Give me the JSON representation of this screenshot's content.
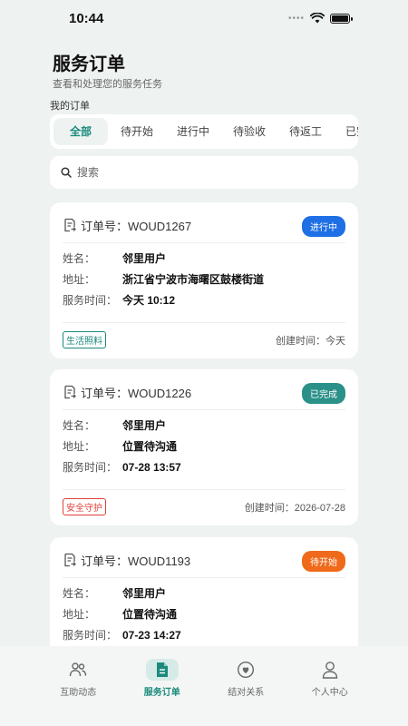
{
  "status_bar": {
    "time": "10:44"
  },
  "header": {
    "title": "服务订单",
    "subtitle": "查看和处理您的服务任务",
    "section_label": "我的订单"
  },
  "tabs": [
    {
      "label": "全部",
      "active": true
    },
    {
      "label": "待开始"
    },
    {
      "label": "进行中"
    },
    {
      "label": "待验收"
    },
    {
      "label": "待返工"
    },
    {
      "label": "已完成"
    }
  ],
  "search": {
    "placeholder": "搜索"
  },
  "labels": {
    "order_prefix": "订单号：",
    "name": "姓名：",
    "address": "地址：",
    "service_time": "服务时间：",
    "created": "创建时间："
  },
  "orders": [
    {
      "order_no": "WOUD1267",
      "status": "进行中",
      "status_color": "#1f6fe5",
      "name": "邻里用户",
      "address": "浙江省宁波市海曙区鼓楼街道",
      "service_time": "今天 10:12",
      "tag": "生活照料",
      "tag_color": "#1b8a7d",
      "created": "今天"
    },
    {
      "order_no": "WOUD1226",
      "status": "已完成",
      "status_color": "#2a9088",
      "name": "邻里用户",
      "address": "位置待沟通",
      "service_time": "07-28 13:57",
      "tag": "安全守护",
      "tag_color": "#e0413a",
      "created": "2026-07-28"
    },
    {
      "order_no": "WOUD1193",
      "status": "待开始",
      "status_color": "#ef6a1a",
      "name": "邻里用户",
      "address": "位置待沟通",
      "service_time": "07-23 14:27"
    }
  ],
  "bottom_nav": [
    {
      "label": "互助动态",
      "icon": "people-icon"
    },
    {
      "label": "服务订单",
      "icon": "document-icon",
      "active": true
    },
    {
      "label": "结对关系",
      "icon": "heart-icon"
    },
    {
      "label": "个人中心",
      "icon": "person-icon"
    }
  ],
  "colors": {
    "accent": "#1b8a7d",
    "background": "#eef2f0"
  }
}
